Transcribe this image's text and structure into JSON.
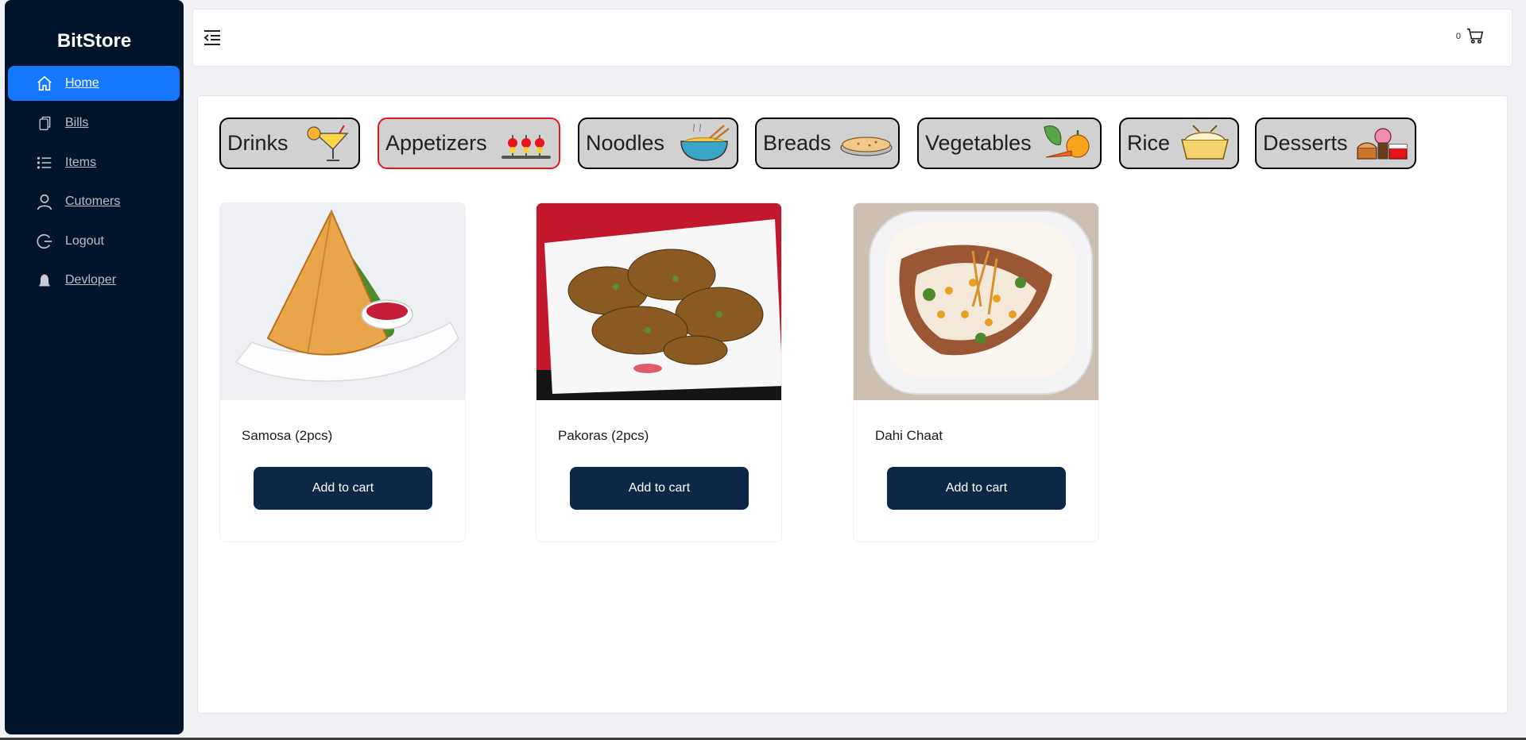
{
  "app": {
    "name": "BitStore"
  },
  "sidebar": {
    "items": [
      {
        "label": "Home",
        "icon": "home-icon"
      },
      {
        "label": "Bills",
        "icon": "bills-icon"
      },
      {
        "label": "Items",
        "icon": "list-icon"
      },
      {
        "label": "Cutomers",
        "icon": "user-icon"
      },
      {
        "label": "Logout",
        "icon": "logout-icon"
      },
      {
        "label": "Devloper",
        "icon": "bell-icon"
      }
    ],
    "active": "Home"
  },
  "header": {
    "cart_count": "0",
    "icons": [
      "menu-fold-icon",
      "cart-icon"
    ]
  },
  "categories": [
    {
      "name": "Drinks",
      "icon": "cocktail-icon"
    },
    {
      "name": "Appetizers",
      "icon": "skewers-icon"
    },
    {
      "name": "Noodles",
      "icon": "noodle-bowl-icon"
    },
    {
      "name": "Breads",
      "icon": "flatbread-icon"
    },
    {
      "name": "Vegetables",
      "icon": "vegetables-icon"
    },
    {
      "name": "Rice",
      "icon": "rice-pot-icon"
    },
    {
      "name": "Desserts",
      "icon": "desserts-icon"
    }
  ],
  "selected_category": "Appetizers",
  "products": [
    {
      "name": "Samosa (2pcs)",
      "button": "Add to cart"
    },
    {
      "name": "Pakoras (2pcs)",
      "button": "Add to cart"
    },
    {
      "name": "Dahi Chaat",
      "button": "Add to cart"
    }
  ],
  "colors": {
    "sidebar_bg": "#001529",
    "active_item": "#1677ff",
    "button_bg": "#0d2847",
    "active_category_border": "#e8141d"
  }
}
